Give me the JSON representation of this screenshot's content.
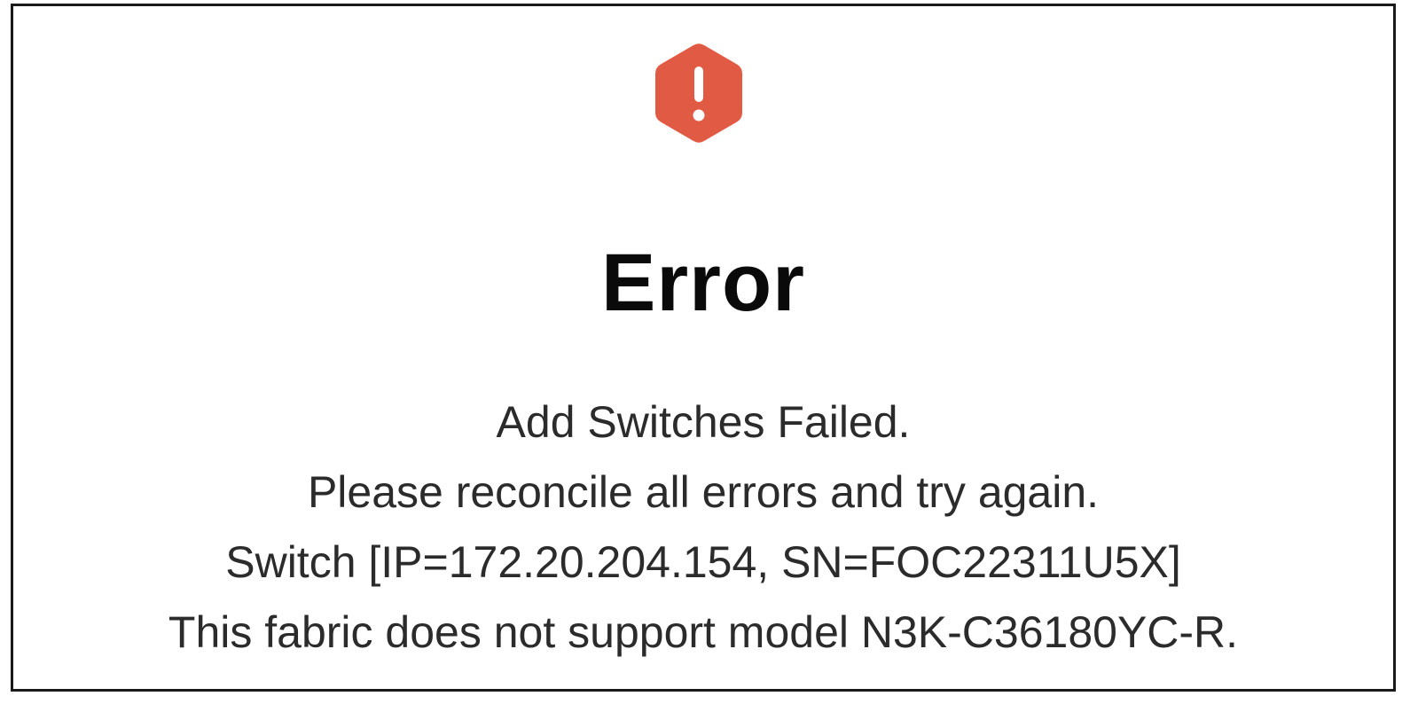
{
  "dialog": {
    "icon": "error-hexagon-icon",
    "icon_color": "#e05a44",
    "title": "Error",
    "messages": [
      "Add Switches Failed.",
      "Please reconcile all errors and try again.",
      "Switch [IP=172.20.204.154, SN=FOC22311U5X]",
      "This fabric does not support model N3K-C36180YC-R."
    ]
  }
}
